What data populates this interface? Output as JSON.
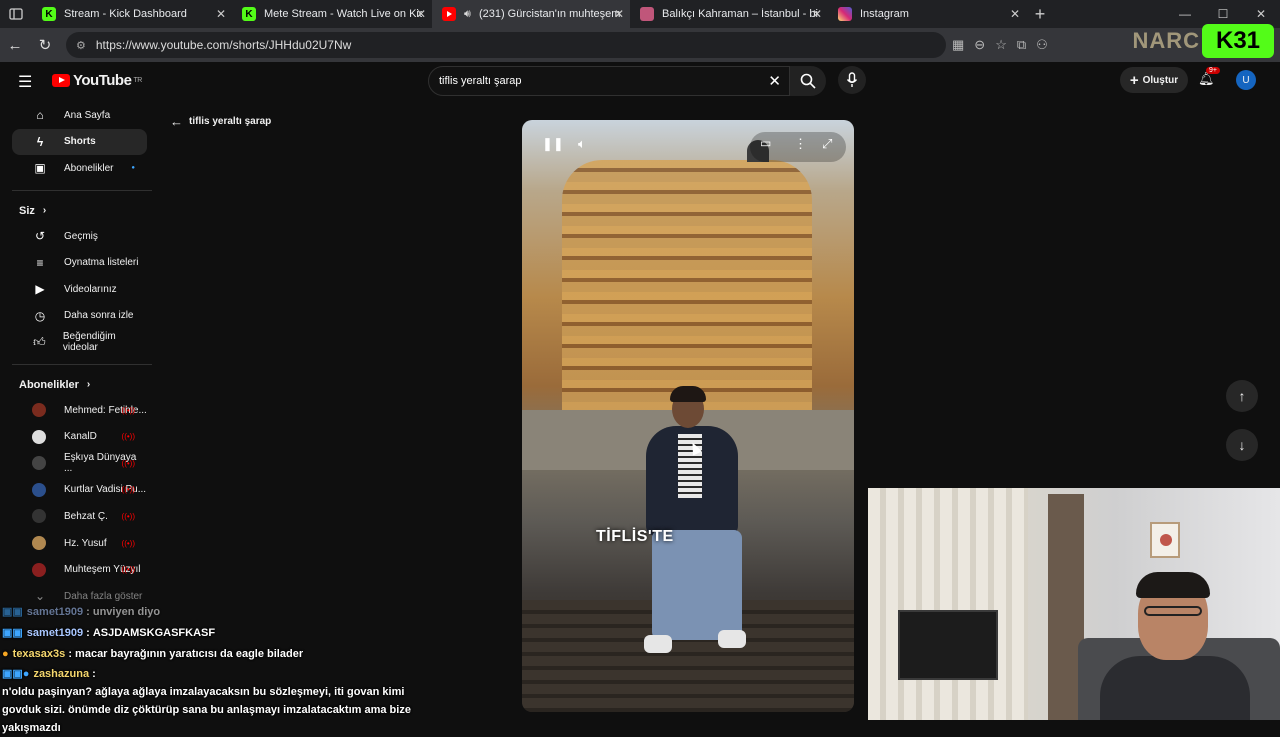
{
  "browser": {
    "tabs": [
      {
        "title": "Stream - Kick Dashboard",
        "favicon": "kick",
        "color": "#53fc18"
      },
      {
        "title": "Mete Stream - Watch Live on Kick",
        "favicon": "kick",
        "color": "#53fc18"
      },
      {
        "title": "(231) Gürcistan'ın muhteşem",
        "favicon": "youtube",
        "color": "#ff0000"
      },
      {
        "title": "Balıkçı Kahraman – İstanbul - bir",
        "favicon": "site",
        "color": "#c0567a"
      },
      {
        "title": "Instagram",
        "favicon": "instagram",
        "color": "#d62976"
      }
    ],
    "url": "https://www.youtube.com/shorts/JHHdu02U7Nw"
  },
  "overlay": {
    "k_badge": "31",
    "narc": "NARC"
  },
  "youtube": {
    "logo_text": "YouTube",
    "logo_region": "TR",
    "search_value": "tiflis yeraltı şarap",
    "create_label": "Oluştur",
    "notif_badge": "9+",
    "avatar_letter": "U",
    "back_label": "tiflis yeraltı şarap"
  },
  "sidebar": {
    "main": [
      {
        "label": "Ana Sayfa",
        "icon": "home-icon"
      },
      {
        "label": "Shorts",
        "icon": "shorts-icon"
      },
      {
        "label": "Abonelikler",
        "icon": "subscriptions-icon"
      }
    ],
    "you_header": "Siz",
    "you": [
      {
        "label": "Geçmiş",
        "icon": "history-icon"
      },
      {
        "label": "Oynatma listeleri",
        "icon": "playlist-icon"
      },
      {
        "label": "Videolarınız",
        "icon": "video-icon"
      },
      {
        "label": "Daha sonra izle",
        "icon": "clock-icon"
      },
      {
        "label": "Beğendiğim videolar",
        "icon": "thumbs-up-icon"
      }
    ],
    "subs_header": "Abonelikler",
    "subs": [
      {
        "label": "Mehmed: Fetihle...",
        "color": "#7a2b1e"
      },
      {
        "label": "KanalD",
        "color": "#dddddd"
      },
      {
        "label": "Eşkıya Dünyaya ...",
        "color": "#444444"
      },
      {
        "label": "Kurtlar Vadisi Pu...",
        "color": "#2b4f8c"
      },
      {
        "label": "Behzat Ç.",
        "color": "#333333"
      },
      {
        "label": "Hz. Yusuf",
        "color": "#b08850"
      },
      {
        "label": "Muhteşem Yüzyıl",
        "color": "#8a1f1f"
      }
    ],
    "more_label": "Daha fazla göster"
  },
  "video": {
    "caption": "TİFLİS'TE"
  },
  "chat": [
    {
      "user": "samet1909",
      "msg": "unviyen diyo",
      "style": "faded"
    },
    {
      "user": "samet1909",
      "msg": "ASJDAMSKGASFKASF",
      "style": "blue"
    },
    {
      "user": "texasax3s",
      "msg": "macar bayrağının yaratıcısı da eagle bilader",
      "style": "gold"
    },
    {
      "user": "zashazuna",
      "msg": "n'oldu paşinyan? ağlaya ağlaya imzalayacaksın bu sözleşmeyi, iti govan kimi govduk sizi. önümde diz çöktürüp sana bu anlaşmayı imzalatacaktım ama bize yakışmazdı",
      "style": "gold"
    }
  ]
}
